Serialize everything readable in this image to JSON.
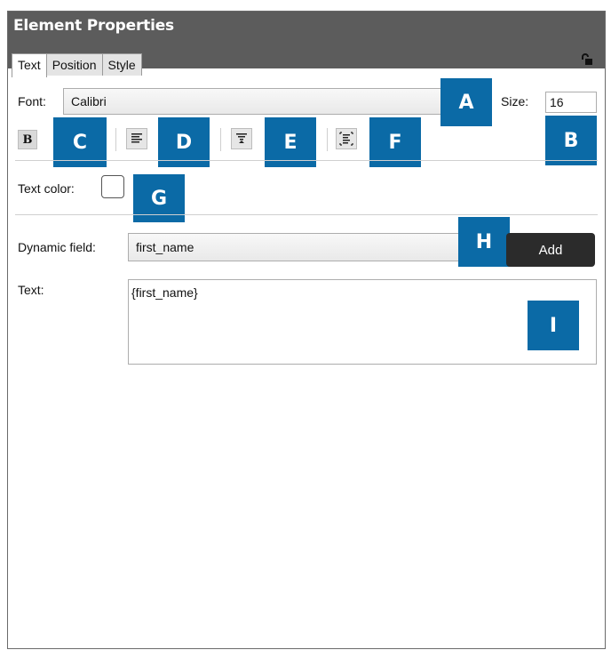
{
  "panel": {
    "title": "Element Properties"
  },
  "tabs": [
    {
      "label": "Text",
      "active": true
    },
    {
      "label": "Position",
      "active": false
    },
    {
      "label": "Style",
      "active": false
    }
  ],
  "font": {
    "label": "Font:",
    "value": "Calibri"
  },
  "size": {
    "label": "Size:",
    "value": "16"
  },
  "toolbar": {
    "bold_label": "B"
  },
  "text_color": {
    "label": "Text color:",
    "value": "#ffffff"
  },
  "dynamic_field": {
    "label": "Dynamic field:",
    "value": "first_name",
    "add_label": "Add"
  },
  "text": {
    "label": "Text:",
    "value": "{first_name}"
  },
  "callouts": {
    "A": "A",
    "B": "B",
    "C": "C",
    "D": "D",
    "E": "E",
    "F": "F",
    "G": "G",
    "H": "H",
    "I": "I"
  },
  "colors": {
    "titlebar": "#5c5c5c",
    "callout": "#0b6aa6",
    "add_button": "#2b2b2b"
  },
  "icons": [
    "lock-icon",
    "align-left-icon",
    "valign-top-icon",
    "autofit-icon"
  ]
}
